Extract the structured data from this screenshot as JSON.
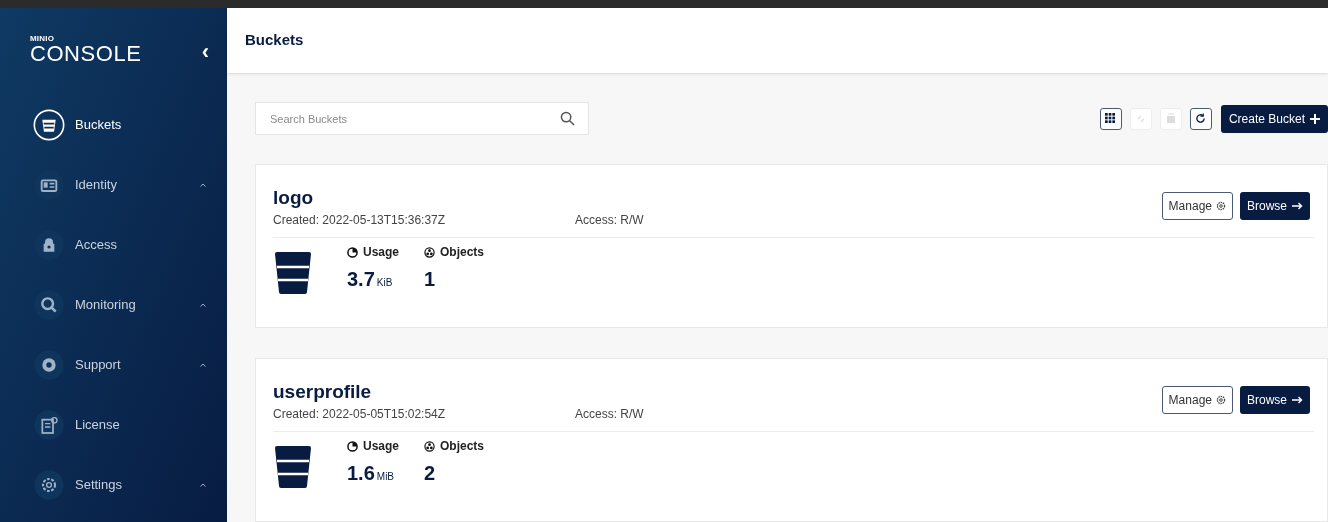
{
  "sidebar": {
    "logo_top": "MINIO",
    "logo_bottom": "CONSOLE",
    "collapse": "‹",
    "items": [
      {
        "label": "Buckets",
        "selected": true,
        "expandable": false
      },
      {
        "label": "Identity",
        "selected": false,
        "expandable": true
      },
      {
        "label": "Access",
        "selected": false,
        "expandable": false
      },
      {
        "label": "Monitoring",
        "selected": false,
        "expandable": true
      },
      {
        "label": "Support",
        "selected": false,
        "expandable": true
      },
      {
        "label": "License",
        "selected": false,
        "expandable": false
      },
      {
        "label": "Settings",
        "selected": false,
        "expandable": true
      }
    ]
  },
  "header": {
    "title": "Buckets"
  },
  "search": {
    "placeholder": "Search Buckets"
  },
  "toolbar": [
    {
      "disabled": false
    },
    {
      "disabled": true
    },
    {
      "disabled": true
    },
    {
      "disabled": false
    }
  ],
  "create_button": "Create Bucket",
  "buckets": [
    {
      "name": "logo",
      "created": "Created: 2022-05-13T15:36:37Z",
      "access": "Access: R/W",
      "usage_label": "Usage",
      "usage_value": "3.7",
      "usage_unit": "KiB",
      "objects_label": "Objects",
      "objects_value": "1",
      "manage_label": "Manage",
      "browse_label": "Browse"
    },
    {
      "name": "userprofile",
      "created": "Created: 2022-05-05T15:02:54Z",
      "access": "Access: R/W",
      "usage_label": "Usage",
      "usage_value": "1.6",
      "usage_unit": "MiB",
      "objects_label": "Objects",
      "objects_value": "2",
      "manage_label": "Manage",
      "browse_label": "Browse"
    }
  ]
}
